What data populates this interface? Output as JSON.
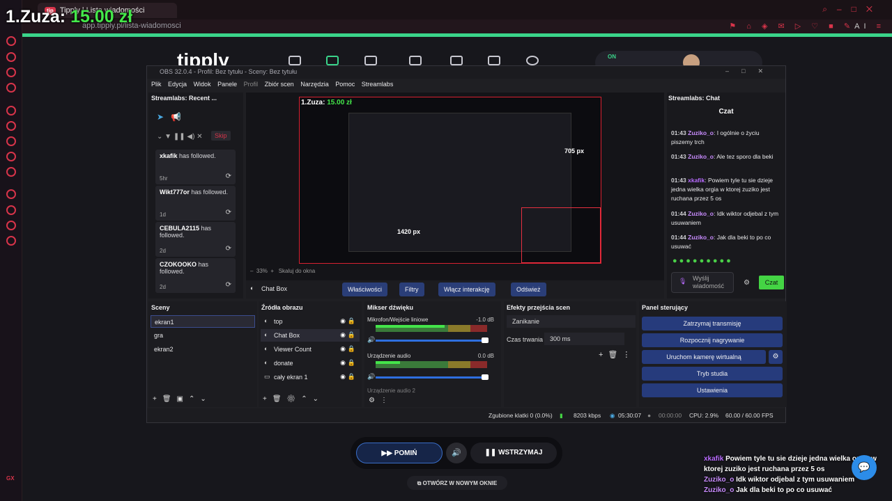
{
  "overlay": {
    "donor": "1.Zuza:",
    "amount": "15.00 zł"
  },
  "browser": {
    "tab_title": "Tipply | Lista wiadomości",
    "tab_favicon": "tip",
    "url": "app.tipply.pl/lista-wiadomosci",
    "gx_label": "GX",
    "ai_label": "AI",
    "accent_color": "#d8344a"
  },
  "tipply": {
    "logo": "tipply",
    "on_badge": "ON",
    "controls": {
      "skip": "POMIŃ",
      "pause": "WSTRZYMAJ",
      "open_window": "OTWÓRZ W NOWYM OKNIE"
    }
  },
  "obs": {
    "title": "OBS 32.0.4 - Profil: Bez tytułu - Sceny: Bez tytułu",
    "menu": [
      "Plik",
      "Edycja",
      "Widok",
      "Panele",
      "Profil",
      "Zbiór scen",
      "Narzędzia",
      "Pomoc",
      "Streamlabs"
    ],
    "recent": {
      "title": "Streamlabs: Recent ...",
      "skip": "Skip",
      "items": [
        {
          "name": "xkafik",
          "action": "has followed.",
          "time": "5hr"
        },
        {
          "name": "Wikt777or",
          "action": "has followed.",
          "time": "1d"
        },
        {
          "name": "CEBULA2115",
          "action": "has followed.",
          "time": "2d"
        },
        {
          "name": "CZOKOOKO",
          "action": "has followed.",
          "time": "2d"
        }
      ]
    },
    "preview": {
      "inner_label": "1.Zuza:",
      "inner_amount": "15.00 zł",
      "width_label": "1420 px",
      "height_label": "705 px",
      "zoom": "33%",
      "scale_label": "Skaluj do okna"
    },
    "source_toolbar": {
      "source": "Chat Box",
      "buttons": [
        "Właściwości",
        "Filtry",
        "Włącz interakcję",
        "Odśwież"
      ]
    },
    "chat": {
      "title": "Streamlabs: Chat",
      "header": "Czat",
      "messages": [
        {
          "time": "01:43",
          "user": "Zuziko_o",
          "text": ": I ogólnie o życiu piszemy trch"
        },
        {
          "time": "01:43",
          "user": "Zuziko_o",
          "text": ": Ale tez sporo dla beki"
        },
        {
          "time": "01:43",
          "user": "xkafik",
          "text": ": Powiem tyle tu sie dzieje jedna wielka orgia w ktorej zuziko jest ruchana przez 5 os"
        },
        {
          "time": "01:44",
          "user": "Zuziko_o",
          "text": ": Idk wiktor odjebal z tym usuwaniem"
        },
        {
          "time": "01:44",
          "user": "Zuziko_o",
          "text": ": Jak dla beki to po co usuwać"
        }
      ],
      "voice": "Wyślij wiadomość",
      "send": "Czat"
    },
    "scenes": {
      "title": "Sceny",
      "items": [
        "ekran1",
        "gra",
        "ekran2"
      ]
    },
    "sources": {
      "title": "Źródła obrazu",
      "items": [
        "top",
        "Chat Box",
        "Viewer Count",
        "donate",
        "cały ekran 1"
      ]
    },
    "mixer": {
      "title": "Mikser dźwięku",
      "channels": [
        {
          "name": "Mikrofon/Wejście liniowe",
          "db": "-1.0 dB",
          "level": 0.62
        },
        {
          "name": "Urządzenie audio",
          "db": "0.0 dB",
          "level": 0.22
        },
        {
          "name": "Urządzenie audio 2",
          "db": "0.0 dB",
          "level": 0
        }
      ],
      "scale": "-60 -55 -50 -45 -40 -35 -30 -25 -20 -15 -10 -5 0"
    },
    "transitions": {
      "title": "Efekty przejścia scen",
      "selected": "Zanikanie",
      "duration_label": "Czas trwania",
      "duration": "300 ms"
    },
    "controls": {
      "title": "Panel sterujący",
      "buttons": [
        "Zatrzymaj transmisję",
        "Rozpocznij nagrywanie",
        "Uruchom kamerę wirtualną",
        "Tryb studia",
        "Ustawienia"
      ]
    },
    "status": {
      "dropped": "Zgubione klatki 0 (0.0%)",
      "kbps": "8203 kbps",
      "stream_time": "05:30:07",
      "rec_time": "00:00:00",
      "cpu": "CPU: 2.9%",
      "fps": "60.00 / 60.00 FPS"
    }
  },
  "stream_chat": [
    {
      "user": "xkafik",
      "text": "Powiem tyle tu sie dzieje jedna wielka orgia w ktorej zuziko jest ruchana przez 5 os"
    },
    {
      "user": "Zuziko_o",
      "text": "Idk wiktor odjebal z tym usuwaniem"
    },
    {
      "user": "Zuziko_o",
      "text": "Jak dla beki to po co usuwać"
    }
  ]
}
